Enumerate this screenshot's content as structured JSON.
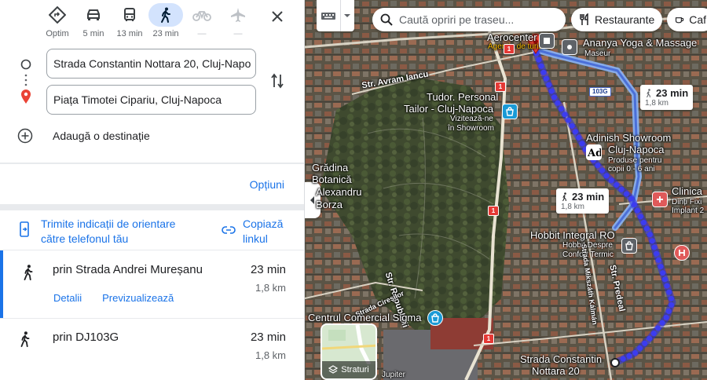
{
  "modes": [
    {
      "name": "mode-best",
      "label": "Optim",
      "icon": "route-diamond-icon",
      "state": "normal"
    },
    {
      "name": "mode-car",
      "label": "5 min",
      "icon": "car-icon",
      "state": "normal"
    },
    {
      "name": "mode-transit",
      "label": "13 min",
      "icon": "bus-icon",
      "state": "normal"
    },
    {
      "name": "mode-walk",
      "label": "23 min",
      "icon": "walk-icon",
      "state": "active"
    },
    {
      "name": "mode-bike",
      "label": "—",
      "icon": "bike-icon",
      "state": "disabled"
    },
    {
      "name": "mode-flight",
      "label": "—",
      "icon": "plane-icon",
      "state": "disabled"
    }
  ],
  "waypoints": {
    "origin": "Strada Constantin Nottara 20, Cluj-Napo",
    "destination": "Piața Timotei Cipariu, Cluj-Napoca"
  },
  "add_destination": "Adaugă o destinație",
  "options_label": "Opțiuni",
  "send_to_phone": "Trimite indicații de orientare către telefonul tău",
  "copy_link": "Copiază linkul",
  "routes": [
    {
      "name": "prin Strada Andrei Mureșanu",
      "time": "23 min",
      "distance": "1,8 km",
      "links": [
        "Detalii",
        "Previzualizează"
      ]
    },
    {
      "name": "prin DJ103G",
      "time": "23 min",
      "distance": "1,8 km"
    }
  ],
  "map": {
    "search_placeholder": "Caută opriri pe traseu...",
    "chips": [
      "Restaurante",
      "Caf"
    ],
    "layers_label": "Straturi",
    "callouts": [
      {
        "time": "23 min",
        "distance": "1,8 km"
      },
      {
        "time": "23 min",
        "distance": "1,8 km"
      }
    ],
    "pois": {
      "aerocenter": "Aerocenter",
      "aerocenter_sub": "Agenție de turism",
      "ananya": "Ananya Yoga & Massage",
      "ananya_sub": "Maseur",
      "avram": "Str. Avram Iancu",
      "tudor_1": "Tudor. Personal",
      "tudor_2": "Tailor - Cluj-Napoca",
      "tudor_sub_1": "Vizitează-ne",
      "tudor_sub_2": "în Showroom",
      "adinish_1": "Adinish Showroom",
      "adinish_2": "Cluj-Napoca",
      "adinish_sub_1": "Produse pentru",
      "adinish_sub_2": "copii 0 - 6 ani",
      "gradina_1": "Grădina",
      "gradina_2": "Botanică",
      "gradina_3": "Alexandru",
      "gradina_4": "Borza",
      "clinica": "Clinica",
      "clinica_sub_1": "Dinți Fixi",
      "clinica_sub_2": "Implant 2",
      "hobbit": "Hobbit Integral RO",
      "hobbit_sub_1": "Hobbit Despre",
      "hobbit_sub_2": "Confort Termic",
      "republicii": "Str. Republicii",
      "cireșilor": "Strada Cireșilor",
      "muncii": "Strada Mikszáth Kálmán",
      "predeal": "Str. Predeal",
      "sigma": "Centrul Comercial Sigma",
      "nottara_1": "Strada Constantin",
      "nottara_2": "Nottara 20",
      "jupiter": "Jupiter"
    },
    "road_shields": [
      "1",
      "1",
      "1",
      "1"
    ],
    "road_badges": [
      "103G"
    ]
  },
  "colors": {
    "accent": "#1a73e8",
    "route": "#3c3cf0",
    "route_alt": "#8ab4f8",
    "mode_active_bg": "#d3e3fd"
  }
}
